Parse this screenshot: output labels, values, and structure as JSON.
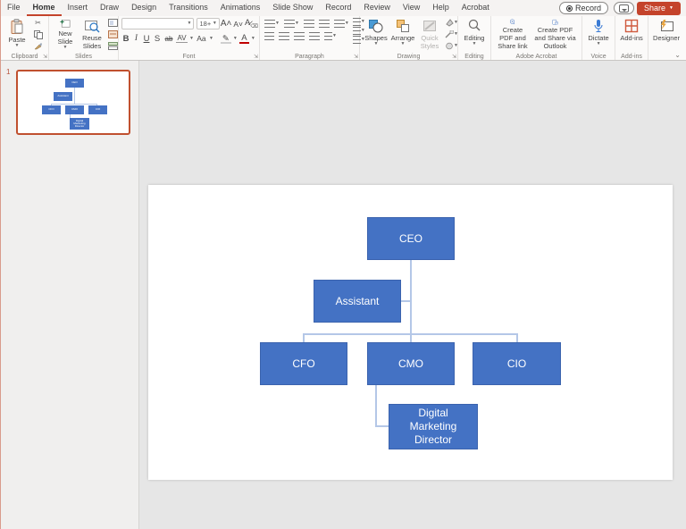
{
  "menubar": {
    "tabs": [
      {
        "label": "File"
      },
      {
        "label": "Home"
      },
      {
        "label": "Insert"
      },
      {
        "label": "Draw"
      },
      {
        "label": "Design"
      },
      {
        "label": "Transitions"
      },
      {
        "label": "Animations"
      },
      {
        "label": "Slide Show"
      },
      {
        "label": "Record"
      },
      {
        "label": "Review"
      },
      {
        "label": "View"
      },
      {
        "label": "Help"
      },
      {
        "label": "Acrobat"
      }
    ],
    "record_button": "Record",
    "share_button": "Share"
  },
  "ribbon": {
    "clipboard": {
      "label": "Clipboard",
      "paste": "Paste"
    },
    "slides": {
      "label": "Slides",
      "new_slide": "New Slide",
      "reuse_slides": "Reuse Slides"
    },
    "font": {
      "label": "Font",
      "size_value": "18+",
      "bold": "B",
      "italic": "I",
      "underline": "U",
      "shadow": "S",
      "strikethrough": "ab",
      "char_spacing": "AV",
      "change_case": "Aa",
      "grow_font": "A",
      "shrink_font": "A",
      "clear_formatting": "A",
      "font_color": "A"
    },
    "paragraph": {
      "label": "Paragraph"
    },
    "drawing": {
      "label": "Drawing",
      "shapes": "Shapes",
      "arrange": "Arrange",
      "quick_styles": "Quick Styles"
    },
    "editing": {
      "label": "Editing"
    },
    "acrobat": {
      "label": "Adobe Acrobat",
      "create_pdf_share": "Create PDF and Share link",
      "create_pdf_outlook": "Create PDF and Share via Outlook"
    },
    "voice": {
      "label": "Voice",
      "dictate": "Dictate"
    },
    "addins": {
      "label": "Add-ins",
      "button": "Add-ins"
    },
    "designer": {
      "label": "Designer"
    }
  },
  "thumbnail_panel": {
    "slide_number": "1"
  },
  "slide": {
    "org_chart": {
      "nodes": {
        "ceo": "CEO",
        "assistant": "Assistant",
        "cfo": "CFO",
        "cmo": "CMO",
        "cio": "CIO",
        "dmd": "Digital Marketing Director"
      },
      "edges": [
        [
          "CEO",
          "Assistant"
        ],
        [
          "CEO",
          "CFO"
        ],
        [
          "CEO",
          "CMO"
        ],
        [
          "CEO",
          "CIO"
        ],
        [
          "CMO",
          "Digital Marketing Director"
        ]
      ]
    }
  },
  "colors": {
    "box_fill": "#4472C4",
    "connector": "#B4C7E7",
    "share_button": "#C4432B",
    "active_tab_underline": "#C4432B",
    "thumbnail_selection": "#C0502F"
  }
}
